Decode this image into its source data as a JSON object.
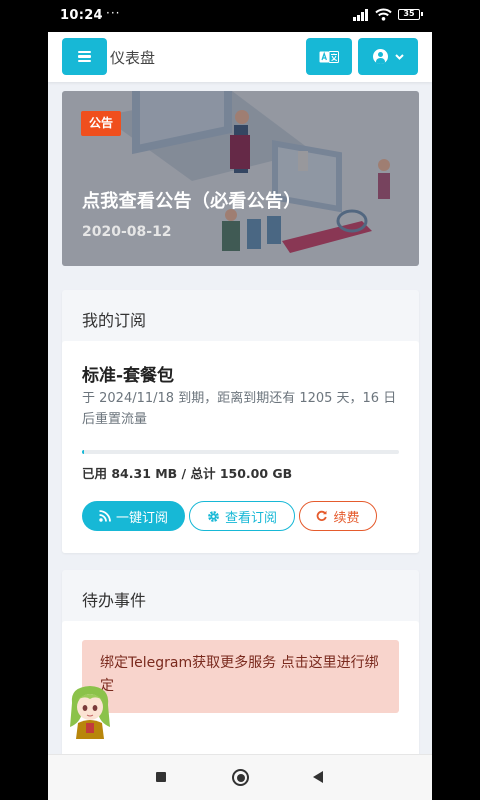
{
  "status_bar": {
    "time": "10:24",
    "dots": "···",
    "battery": "35",
    "icons": [
      "signal-icon",
      "wifi-icon",
      "battery-icon"
    ]
  },
  "header": {
    "title": "仪表盘",
    "accent_color": "#17b8d6",
    "icons": [
      "menu-icon",
      "translate-icon",
      "user-icon",
      "chevron-down-icon"
    ]
  },
  "announcement": {
    "badge": "公告",
    "title": "点我查看公告（必看公告）",
    "date": "2020-08-12",
    "badge_color": "#f04f1d"
  },
  "subscription": {
    "section_title": "我的订阅",
    "plan_name": "标准-套餐包",
    "description": "于 2024/11/18 到期，距离到期还有 1205 天，16 日后重置流量",
    "usage_text": "已用 84.31 MB / 总计 150.00 GB",
    "usage_fraction": 0.0005,
    "buttons": {
      "subscribe": "一键订阅",
      "view": "查看订阅",
      "renew": "续费"
    }
  },
  "todo": {
    "section_title": "待办事件",
    "alert_text": "绑定Telegram获取更多服务 点击这里进行绑定",
    "alert_color": "#f8d4cc"
  },
  "nav_bar": {
    "icons": [
      "recent-apps-icon",
      "home-icon",
      "back-icon"
    ]
  }
}
